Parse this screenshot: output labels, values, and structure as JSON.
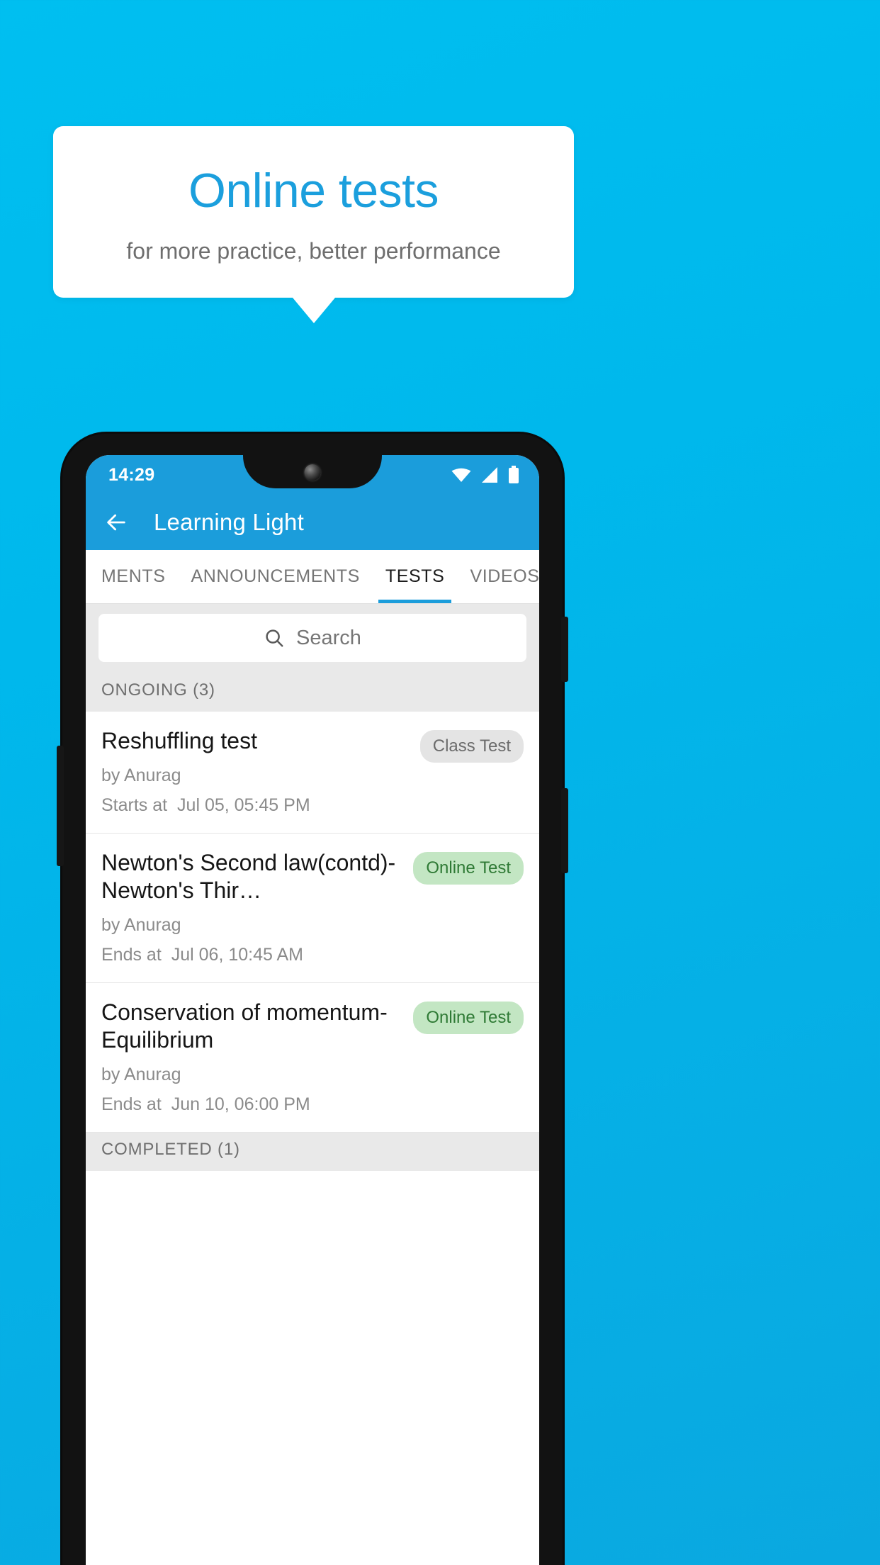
{
  "promo": {
    "title": "Online tests",
    "subtitle": "for more practice, better performance",
    "title_color": "#1b9fdd",
    "background_color": "#00bdee"
  },
  "statusbar": {
    "time": "14:29",
    "icons": [
      "wifi-icon",
      "signal-icon",
      "battery-icon"
    ]
  },
  "appbar": {
    "back_icon": "back-arrow-icon",
    "title": "Learning Light",
    "color": "#1b9ddb"
  },
  "tabs": {
    "items": [
      {
        "label": "MENTS",
        "active": false
      },
      {
        "label": "ANNOUNCEMENTS",
        "active": false
      },
      {
        "label": "TESTS",
        "active": true
      },
      {
        "label": "VIDEOS",
        "active": false
      }
    ],
    "indicator_color": "#1b9ddb"
  },
  "search": {
    "placeholder": "Search",
    "value": "",
    "icon": "search-icon"
  },
  "sections": [
    {
      "header": "ONGOING (3)",
      "rows": [
        {
          "title": "Reshuffling test",
          "author": "by Anurag",
          "when_label": "Starts at",
          "when_value": "Jul 05, 05:45 PM",
          "badge": "Class Test",
          "badge_style": "grey"
        },
        {
          "title": "Newton's Second law(contd)-Newton's Thir…",
          "author": "by Anurag",
          "when_label": "Ends at",
          "when_value": "Jul 06, 10:45 AM",
          "badge": "Online Test",
          "badge_style": "green"
        },
        {
          "title": "Conservation of momentum-Equilibrium",
          "author": "by Anurag",
          "when_label": "Ends at",
          "when_value": "Jun 10, 06:00 PM",
          "badge": "Online Test",
          "badge_style": "green"
        }
      ]
    },
    {
      "header": "COMPLETED (1)",
      "rows": []
    }
  ]
}
